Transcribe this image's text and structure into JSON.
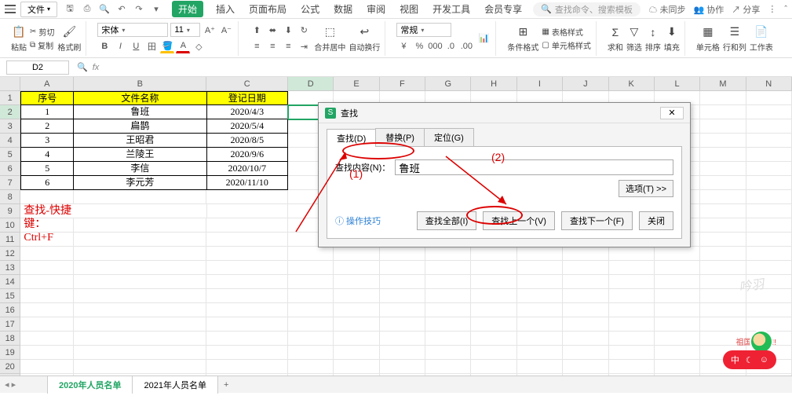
{
  "menubar": {
    "file_label": "文件",
    "tabs": [
      "开始",
      "插入",
      "页面布局",
      "公式",
      "数据",
      "审阅",
      "视图",
      "开发工具",
      "会员专享"
    ],
    "search_placeholder": "查找命令、搜索模板",
    "right": {
      "unsync": "未同步",
      "coop": "协作",
      "share": "分享"
    }
  },
  "ribbon": {
    "paste": "粘贴",
    "cut": "剪切",
    "copy": "复制",
    "format_painter": "格式刷",
    "font_name": "宋体",
    "font_size": "11",
    "merge_center": "合并居中",
    "wrap": "自动换行",
    "number_format": "常规",
    "conditional": "条件格式",
    "table_style": "表格样式",
    "cell_style": "单元格样式",
    "sum": "求和",
    "filter": "筛选",
    "sort": "排序",
    "fill": "填充",
    "cells": "单元格",
    "row_col": "行和列",
    "sheet": "工作表"
  },
  "name_box": "D2",
  "columns": [
    "A",
    "B",
    "C",
    "D",
    "E",
    "F",
    "G",
    "H",
    "I",
    "J",
    "K",
    "L",
    "M",
    "N"
  ],
  "table": {
    "headers": {
      "a": "序号",
      "b": "文件名称",
      "c": "登记日期"
    },
    "rows": [
      {
        "a": "1",
        "b": "鲁班",
        "c": "2020/4/3"
      },
      {
        "a": "2",
        "b": "扁鹊",
        "c": "2020/5/4"
      },
      {
        "a": "3",
        "b": "王昭君",
        "c": "2020/8/5"
      },
      {
        "a": "4",
        "b": "兰陵王",
        "c": "2020/9/6"
      },
      {
        "a": "5",
        "b": "李信",
        "c": "2020/10/7"
      },
      {
        "a": "6",
        "b": "李元芳",
        "c": "2020/11/10"
      }
    ],
    "note": "查找-快捷键：Ctrl+F"
  },
  "dialog": {
    "title": "查找",
    "tabs": {
      "find": "查找(D)",
      "replace": "替换(P)",
      "goto": "定位(G)"
    },
    "find_label": "查找内容(N)：",
    "find_value": "鲁班",
    "options_btn": "选项(T) >>",
    "tip": "操作技巧",
    "find_all": "查找全部(I)",
    "find_prev": "查找上一个(V)",
    "find_next": "查找下一个(F)",
    "close": "关闭"
  },
  "annotations": {
    "one": "(1)",
    "two": "(2)"
  },
  "sheets": {
    "s1": "2020年人员名单",
    "s2": "2021年人员名单"
  },
  "watermark": "吟羽",
  "avatar_banner": "祖国万岁~!!",
  "status_pill": "中"
}
